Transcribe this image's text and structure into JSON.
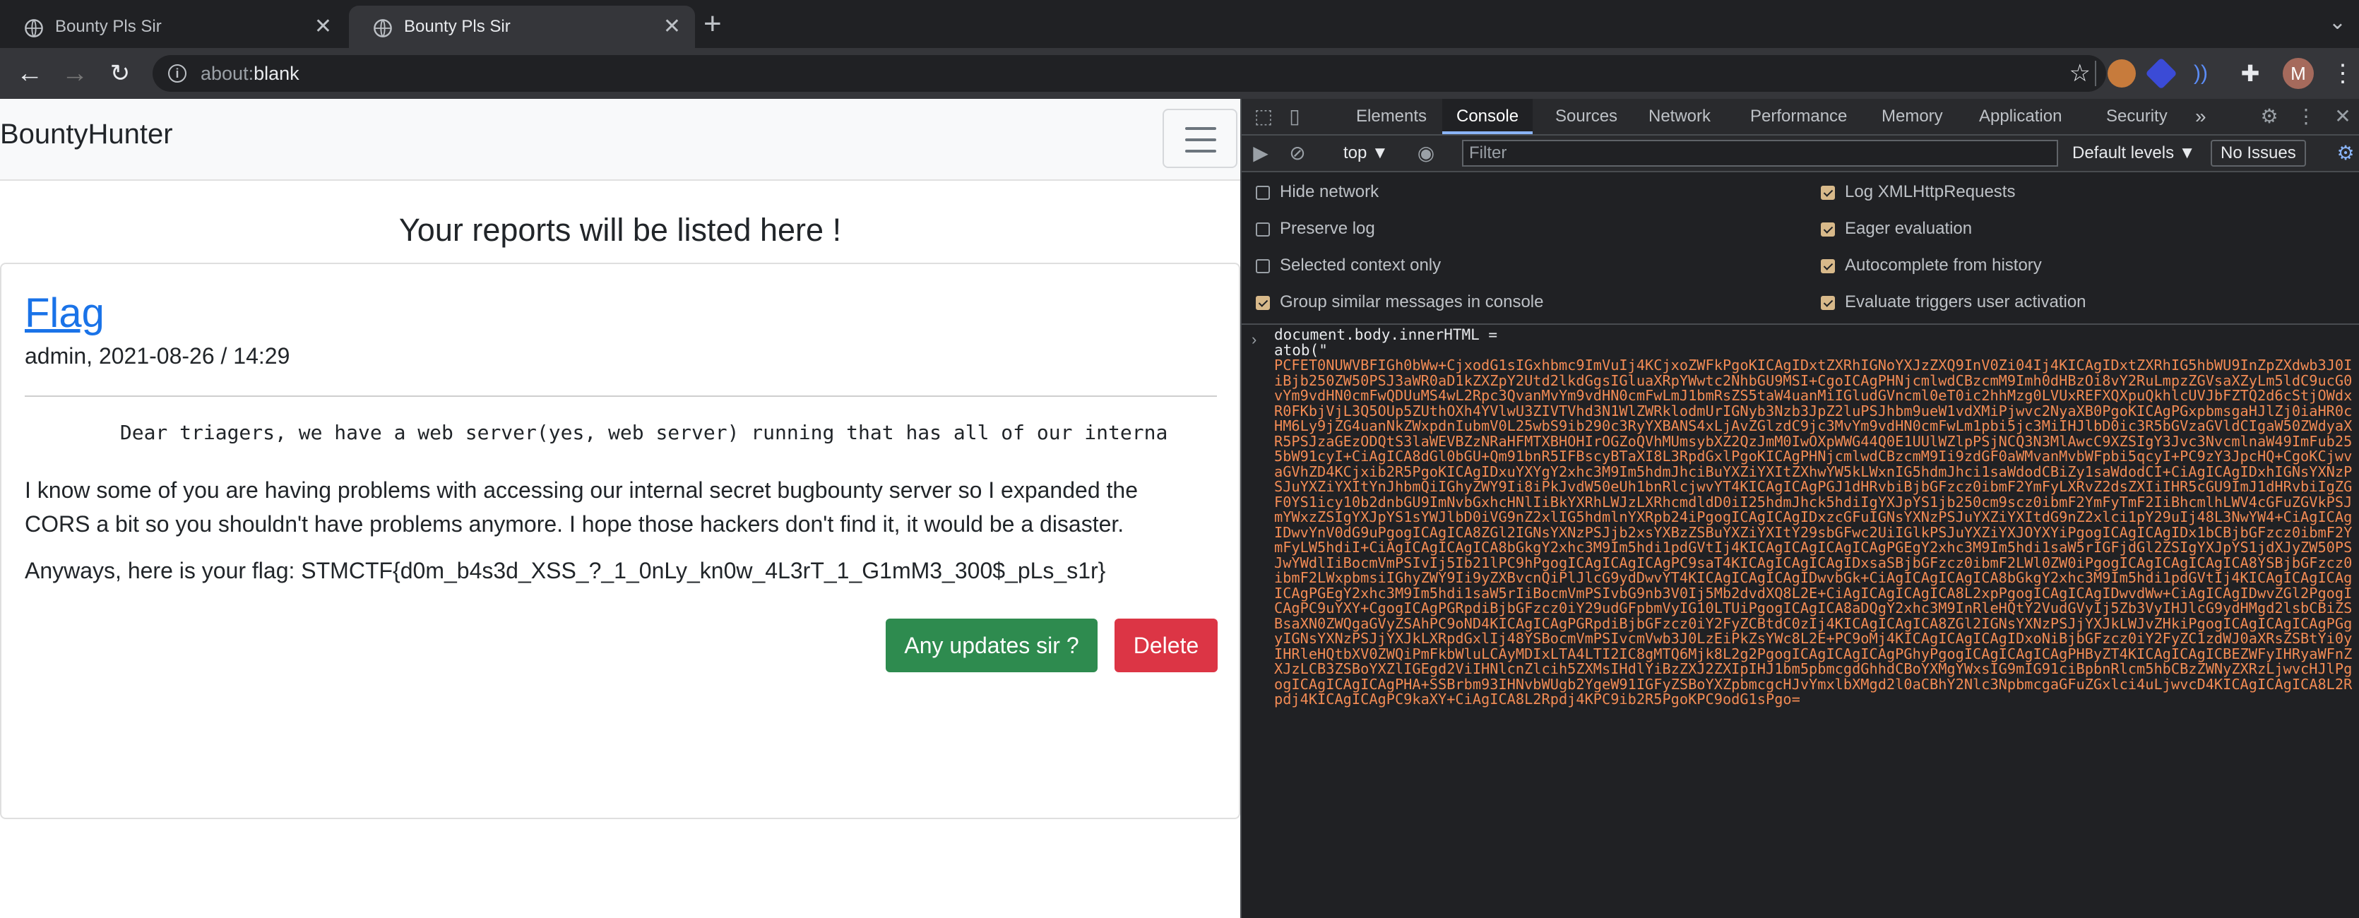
{
  "browser": {
    "tabs": [
      {
        "title": "Bounty Pls Sir",
        "active": false
      },
      {
        "title": "Bounty Pls Sir",
        "active": true
      }
    ],
    "url_scheme": "about:",
    "url_rest": "blank",
    "colors": {
      "tabstrip": "#202124",
      "toolbar": "#35363a"
    }
  },
  "page": {
    "brand": "BountyHunter",
    "heading": "Your reports will be listed here !",
    "report": {
      "title": "Flag",
      "meta": "admin, 2021-08-26 / 14:29",
      "pre_text": "        Dear triagers, we have a web server(yes, web server) running that has all of our interna",
      "para1": "I know some of you are having problems with accessing our internal secret bugbounty server so I expanded the CORS a bit so you shouldn't have problems anymore. I hope those hackers don't find it, it would be a disaster.",
      "para2": "Anyways, here is your flag: STMCTF{d0m_b4s3d_XSS_?_1_0nLy_kn0w_4L3rT_1_G1mM3_300$_pLs_s1r}",
      "update_button": "Any updates sir ?",
      "delete_button": "Delete"
    },
    "colors": {
      "link": "#1a73e8",
      "success": "#2e8b4f",
      "danger": "#dc3545"
    }
  },
  "devtools": {
    "tabs": [
      "Elements",
      "Console",
      "Sources",
      "Network",
      "Performance",
      "Memory",
      "Application",
      "Security"
    ],
    "active_tab": "Console",
    "more_tabs": "»",
    "context": "top ▼",
    "filter_placeholder": "Filter",
    "levels": "Default levels ▼",
    "issues": "No Issues",
    "settings_left": [
      {
        "label": "Hide network",
        "checked": false
      },
      {
        "label": "Preserve log",
        "checked": false
      },
      {
        "label": "Selected context only",
        "checked": false
      },
      {
        "label": "Group similar messages in console",
        "checked": true
      }
    ],
    "settings_right": [
      {
        "label": "Log XMLHttpRequests",
        "checked": true
      },
      {
        "label": "Eager evaluation",
        "checked": true
      },
      {
        "label": "Autocomplete from history",
        "checked": true
      },
      {
        "label": "Evaluate triggers user activation",
        "checked": true
      }
    ],
    "command_line1": "document.body.innerHTML =",
    "command_line2": "atob(\"",
    "b64": "PCFET0NUWVBFIGh0bWw+CjxodG1sIGxhbmc9ImVuIj4KCjxoZWFkPgoKICAgIDxtZXRhIGNoYXJzZXQ9InV0Zi04Ij4KICAgIDxtZXRhIG5hbWU9InZpZXdwb3J0IiBjb250ZW50PSJ3aWR0aD1kZXZpY2Utd2lkdGgsIGluaXRpYWwtc2NhbGU9MSI+CgoICAgPHNjcmlwdCBzcmM9Imh0dHBzOi8vY2RuLmpzZGVsaXZyLm5ldC9ucG0vYm9vdHN0cmFwQDUuMS4wL2Rpc3QvanMvYm9vdHN0cmFwLmJ1bmRsZS5taW4uanMiIGludGVncml0eT0ic2hhMzg0LVUxREFXQXpuQkhlcUVJbFZTQ2d6cStjOWdxR0FKbjVjL3Q5OUp5ZUthOXh4YVlwU3ZIVTVhd3N1WlZWRklodmUrIGNyb3Nzb3JpZ2luPSJhbm9ueW1vdXMiPjwvc2NyaXB0PgoKICAgPGxpbmsgaHJlZj0iaHR0cHM6Ly9jZG4uanNkZWxpdnIubmV0L25wbS9ib290c3RyYXBANS4xLjAvZGlzdC9jc3MvYm9vdHN0cmFwLm1pbi5jc3MiIHJlbD0ic3R5bGVzaGVldCIgaW50ZWdyaXR5PSJzaGEzODQtS3laWEVBZzNRaHFMTXBHOHIrOGZoQVhMUmsybXZ2QzJmM0IwOXpWWG44Q0E1UUlWZlpPSjNCQ3N3MlAwcC9XZSIgY3Jvc3NvcmlnaW49ImFub255bW91cyI+CiAgICA8dGl0bGU+Qm91bnR5IFBscyBTaXI8L3RpdGxlPgoKICAgPHNjcmlwdCBzcmM9Ii9zdGF0aWMvanMvbWFpbi5qcyI+PC9zY3JpcHQ+CgoKCjwvaGVhZD4KCjxib2R5PgoKICAgIDxuYXYgY2xhc3M9Im5hdmJhciBuYXZiYXItZXhwYW5kLWxnIG5hdmJhci1saWdodCBiZy1saWdodCI+CiAgICAgIDxhIGNsYXNzPSJuYXZiYXItYnJhbmQiIGhyZWY9Ii8iPkJvdW50eUh1bnRlcjwvYT4KICAgICAgPGJ1dHRvbiBjbGFzcz0ibmF2YmFyLXRvZ2dsZXIiIHR5cGU9ImJ1dHRvbiIgZGF0YS1icy10b2dnbGU9ImNvbGxhcHNlIiBkYXRhLWJzLXRhcmdldD0iI25hdmJhck5hdiIgYXJpYS1jb250cm9scz0ibmF2YmFyTmF2IiBhcmlhLWV4cGFuZGVkPSJmYWxzZSIgYXJpYS1sYWJlbD0iVG9nZ2xlIG5hdmlnYXRpb24iPgogICAgICAgIDxzcGFuIGNsYXNzPSJuYXZiYXItdG9nZ2xlci1pY29uIj48L3NwYW4+CiAgICAgIDwvYnV0dG9uPgogICAgICA8ZGl2IGNsYXNzPSJjb2xsYXBzZSBuYXZiYXItY29sbGFwc2UiIGlkPSJuYXZiYXJOYXYiPgogICAgICAgIDx1bCBjbGFzcz0ibmF2YmFyLW5hdiI+CiAgICAgICAgICA8bGkgY2xhc3M9Im5hdi1pdGVtIj4KICAgICAgICAgICAgPGEgY2xhc3M9Im5hdi1saW5rIGFjdGl2ZSIgYXJpYS1jdXJyZW50PSJwYWdlIiBocmVmPSIvIj5Ib21lPC9hPgogICAgICAgICAgPC9saT4KICAgICAgICAgIDxsaSBjbGFzcz0ibmF2LWl0ZW0iPgogICAgICAgICAgICA8YSBjbGFzcz0ibmF2LWxpbmsiIGhyZWY9Ii9yZXBvcnQiPlJlcG9ydDwvYT4KICAgICAgICAgIDwvbGk+CiAgICAgICAgICA8bGkgY2xhc3M9Im5hdi1pdGVtIj4KICAgICAgICAgICAgPGEgY2xhc3M9Im5hdi1saW5rIiBocmVmPSIvbG9nb3V0Ij5Mb2dvdXQ8L2E+CiAgICAgICAgICA8L2xpPgogICAgICAgIDwvdWw+CiAgICAgIDwvZGl2PgogICAgPC9uYXY+CgogICAgPGRpdiBjbGFzcz0iY29udGFpbmVyIG10LTUiPgogICAgICA8aDQgY2xhc3M9InRleHQtY2VudGVyIj5Zb3VyIHJlcG9ydHMgd2lsbCBiZSBsaXN0ZWQgaGVyZSAhPC9oND4KICAgICAgPGRpdiBjbGFzcz0iY2FyZCBtdC0zIj4KICAgICAgICA8ZGl2IGNsYXNzPSJjYXJkLWJvZHkiPgogICAgICAgICAgPGgyIGNsYXNzPSJjYXJkLXRpdGxlIj48YSBocmVmPSIvcmVwb3J0LzEiPkZsYWc8L2E+PC9oMj4KICAgICAgICAgIDxoNiBjbGFzcz0iY2FyZC1zdWJ0aXRsZSBtYi0yIHRleHQtbXV0ZWQiPmFkbWluLCAyMDIxLTA4LTI2IC8gMTQ6Mjk8L2g2PgogICAgICAgICAgPGhyPgogICAgICAgICAgPHByZT4KICAgICAgICBEZWFyIHRyaWFnZXJzLCB3ZSBoYXZlIGEgd2ViIHNlcnZlcih5ZXMsIHdlYiBzZXJ2ZXIpIHJ1bm5pbmcgdGhhdCBoYXMgYWxsIG9mIG91ciBpbnRlcm5hbCBzZWNyZXRzLjwvcHJlPgogICAgICAgICAgPHA+SSBrbm93IHNvbWUgb2YgeW91IGFyZSBoYXZpbmcgcHJvYmxlbXMgd2l0aCBhY2Nlc3NpbmcgaGFuZGxlci4uLjwvcD4KICAgICAgICA8L2Rpdj4KICAgICAgPC9kaXY+CiAgICA8L2Rpdj4KPC9ib2R5PgoKPC9odG1sPgo="
  }
}
